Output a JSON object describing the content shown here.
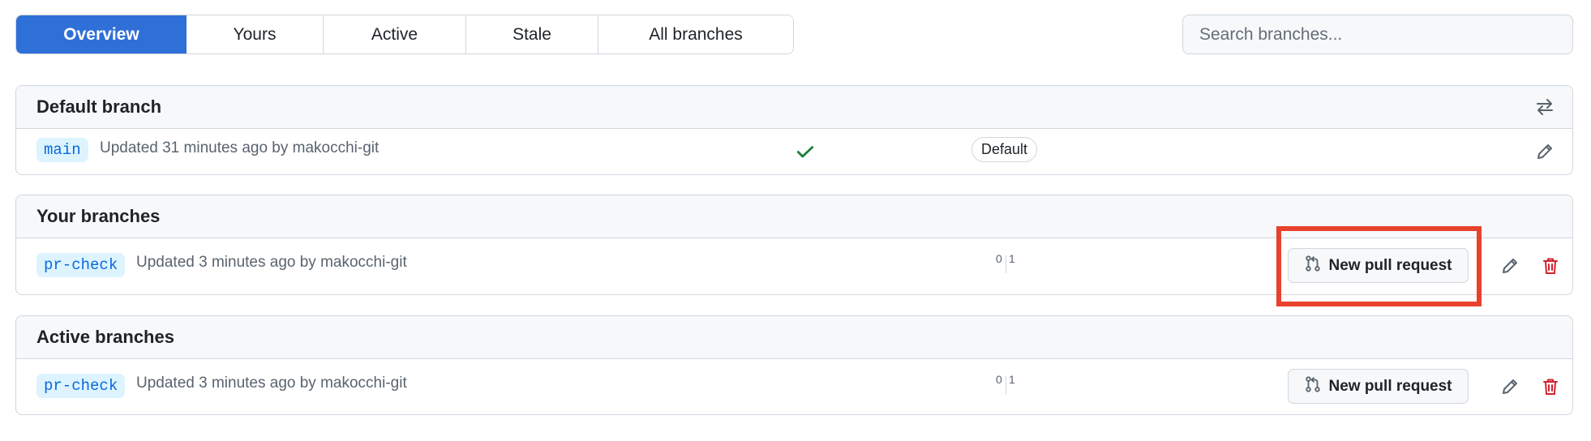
{
  "tabs": [
    {
      "label": "Overview",
      "active": true
    },
    {
      "label": "Yours",
      "active": false
    },
    {
      "label": "Active",
      "active": false
    },
    {
      "label": "Stale",
      "active": false
    },
    {
      "label": "All branches",
      "active": false
    }
  ],
  "search": {
    "placeholder": "Search branches..."
  },
  "default_branch": {
    "title": "Default branch",
    "icons": {
      "header": "arrows-switch-icon",
      "edit": "pencil-icon",
      "status": "check-icon"
    },
    "row": {
      "branch": "main",
      "meta": "Updated 31 minutes ago by makocchi-git",
      "badge": "Default",
      "status_color": "#1a7f37"
    }
  },
  "your_branches": {
    "title": "Your branches",
    "row": {
      "branch": "pr-check",
      "meta": "Updated 3 minutes ago by makocchi-git",
      "behind": "0",
      "ahead": "1",
      "pr_button": "New pull request"
    }
  },
  "active_branches": {
    "title": "Active branches",
    "row": {
      "branch": "pr-check",
      "meta": "Updated 3 minutes ago by makocchi-git",
      "behind": "0",
      "ahead": "1",
      "pr_button": "New pull request"
    }
  },
  "colors": {
    "accent": "#2f6fd8",
    "delete": "#cf222e",
    "highlight": "#e8412c",
    "branch_tag_bg": "#ddf4ff",
    "branch_tag_fg": "#0969da"
  }
}
